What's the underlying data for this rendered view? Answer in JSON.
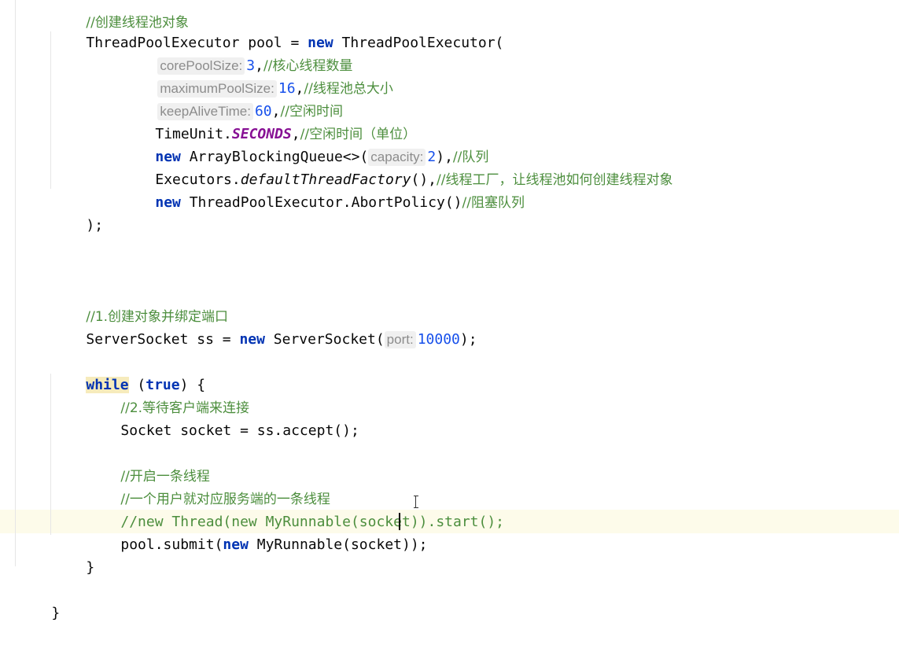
{
  "editor": {
    "lines": {
      "l0_comment": "//创建线程池对象",
      "l1_type": "ThreadPoolExecutor",
      "l1_var": " pool = ",
      "l1_new": "new",
      "l1_ctor": " ThreadPoolExecutor(",
      "l2_hint": "corePoolSize:",
      "l2_value": "3",
      "l2_comma": ",",
      "l2_comment": "//核心线程数量",
      "l3_hint": "maximumPoolSize:",
      "l3_value": "16",
      "l3_comma": ",",
      "l3_comment": "//线程池总大小",
      "l4_hint": "keepAliveTime:",
      "l4_value": "60",
      "l4_comma": ",",
      "l4_comment": "//空闲时间",
      "l5_pre": "TimeUnit.",
      "l5_const": "SECONDS",
      "l5_comma": ",",
      "l5_comment": "//空闲时间（单位）",
      "l6_new": "new",
      "l6_ctor": " ArrayBlockingQueue<>(",
      "l6_hint": "capacity:",
      "l6_value": "2",
      "l6_post": "),",
      "l6_comment": "//队列",
      "l7_pre": "Executors.",
      "l7_method": "defaultThreadFactory",
      "l7_post": "(),",
      "l7_comment": "//线程工厂，让线程池如何创建线程对象",
      "l8_new": "new",
      "l8_ctor": " ThreadPoolExecutor.AbortPolicy()",
      "l8_comment": "//阻塞队列",
      "l9_close": ");",
      "l10_comment": "//1.创建对象并绑定端口",
      "l11_pre": "ServerSocket ss = ",
      "l11_new": "new",
      "l11_ctor": " ServerSocket(",
      "l11_hint": "port:",
      "l11_value": "10000",
      "l11_post": ");",
      "l12_while": "while",
      "l12_mid": " (",
      "l12_true": "true",
      "l12_post": ") {",
      "l13_comment": "//2.等待客户端来连接",
      "l14_code": "Socket socket = ss.accept();",
      "l15_comment": "//开启一条线程",
      "l16_comment": "//一个用户就对应服务端的一条线程",
      "l17_comment": "//new Thread(new MyRunnable(socket)).start();",
      "l18_pre": "pool.submit(",
      "l18_new": "new",
      "l18_post": " MyRunnable(socket));",
      "l19_close": "}",
      "l20_close": "}"
    }
  }
}
